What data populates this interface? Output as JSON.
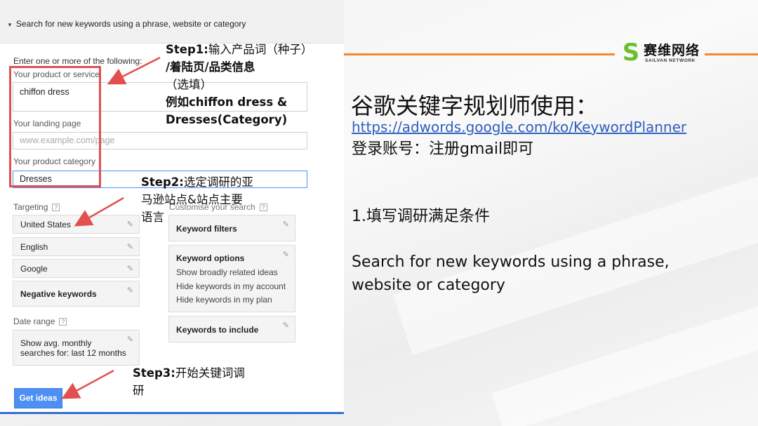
{
  "left_panel": {
    "header": "Search for new keywords using a phrase, website or category",
    "intro": "Enter one or more of the following:",
    "product_label": "Your product or service",
    "product_value": "chiffon dress",
    "landing_label": "Your landing page",
    "landing_placeholder": "www.example.com/page",
    "category_label": "Your product category",
    "category_value": "Dresses",
    "targeting_label": "Targeting",
    "help_glyph": "?",
    "targeting_items": [
      "United States",
      "English",
      "Google",
      "Negative keywords"
    ],
    "customise_label": "Customise your search",
    "keyword_filters": "Keyword filters",
    "keyword_options": {
      "title": "Keyword options",
      "lines": [
        "Show broadly related ideas",
        "Hide keywords in my account",
        "Hide keywords in my plan"
      ]
    },
    "keywords_to_include": "Keywords to include",
    "date_range_label": "Date range",
    "date_range_value_line1": "Show avg. monthly",
    "date_range_value_line2": "searches for: last 12 months",
    "get_ideas_button": "Get ideas"
  },
  "annotations": {
    "step1": {
      "label": "Step1:",
      "lines": [
        "输入产品词（种子）",
        "/着陆页/品类信息",
        "（选填）",
        "例如chiffon dress &",
        "Dresses(Category)"
      ]
    },
    "step2": {
      "label": "Step2:",
      "lines": [
        "选定调研的亚",
        "马逊站点&站点主要",
        "语言"
      ]
    },
    "step3": {
      "label": "Step3:",
      "lines": [
        "开始关键词调",
        "研"
      ]
    }
  },
  "slide": {
    "logo_cn": "赛维网络",
    "logo_en": "SAILVAN NETWORK",
    "title": "谷歌关键字规划师使用：",
    "link": "https://adwords.google.com/ko/KeywordPlanner",
    "login_note": "登录账号：注册gmail即可",
    "step_heading": "1.填写调研满足条件",
    "desc_line1": "Search for new keywords using a phrase,",
    "desc_line2": "website or category"
  },
  "colors": {
    "accent_orange": "#f08a2c",
    "annotation_red": "#e05050",
    "button_blue": "#4d8ff2",
    "link_blue": "#2e5fbf",
    "logo_green": "#6abf2e"
  }
}
